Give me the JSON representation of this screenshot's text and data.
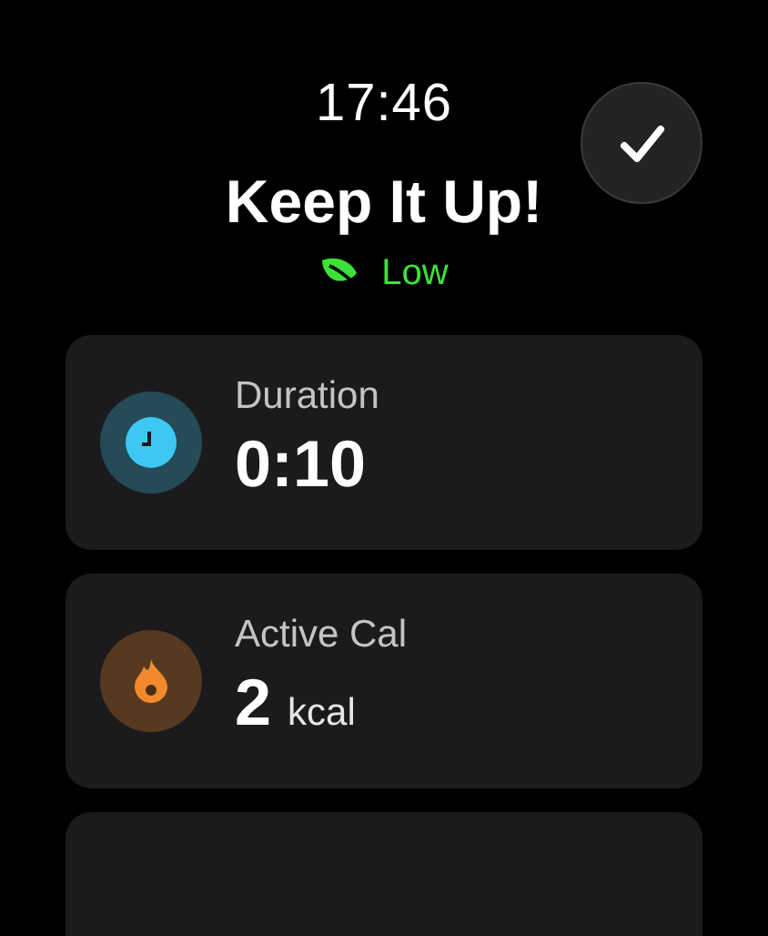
{
  "status_bar": {
    "time": "17:46"
  },
  "done_button": {
    "kind": "check"
  },
  "title": "Keep It Up!",
  "intensity": {
    "label": "Low",
    "color": "#3ee13a"
  },
  "metrics": [
    {
      "kind": "clock",
      "label": "Duration",
      "value": "0:10",
      "color": "#3cc8f2"
    },
    {
      "kind": "flame",
      "label": "Active Cal",
      "value": "2",
      "unit": "kcal",
      "color": "#f08a2c"
    }
  ]
}
